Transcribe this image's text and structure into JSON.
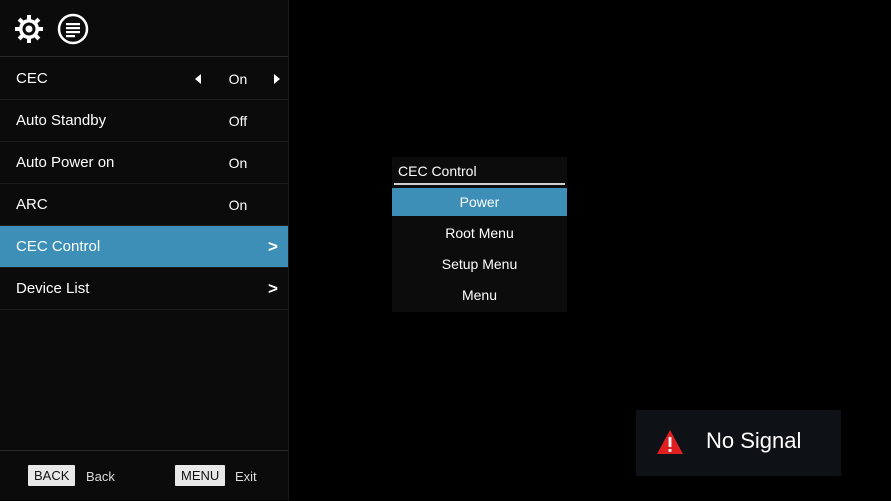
{
  "toolbar": {
    "icons": [
      "gear-icon",
      "list-icon"
    ]
  },
  "menu": {
    "items": [
      {
        "label": "CEC",
        "value": "On",
        "type": "toggle"
      },
      {
        "label": "Auto Standby",
        "value": "Off",
        "type": "value"
      },
      {
        "label": "Auto Power on",
        "value": "On",
        "type": "value"
      },
      {
        "label": "ARC",
        "value": "On",
        "type": "value"
      },
      {
        "label": "CEC Control",
        "value": "",
        "type": "submenu",
        "selected": true
      },
      {
        "label": "Device List",
        "value": "",
        "type": "submenu"
      }
    ]
  },
  "footer": {
    "back_key": "BACK",
    "back_label": "Back",
    "menu_key": "MENU",
    "exit_label": "Exit"
  },
  "submenu": {
    "title": "CEC Control",
    "items": [
      "Power",
      "Root Menu",
      "Setup Menu",
      "Menu"
    ],
    "selected_index": 0
  },
  "status": {
    "message": "No Signal",
    "icon": "warning-icon"
  },
  "colors": {
    "accent": "#3d8fb7",
    "warning": "#e02020",
    "background": "#000000"
  }
}
